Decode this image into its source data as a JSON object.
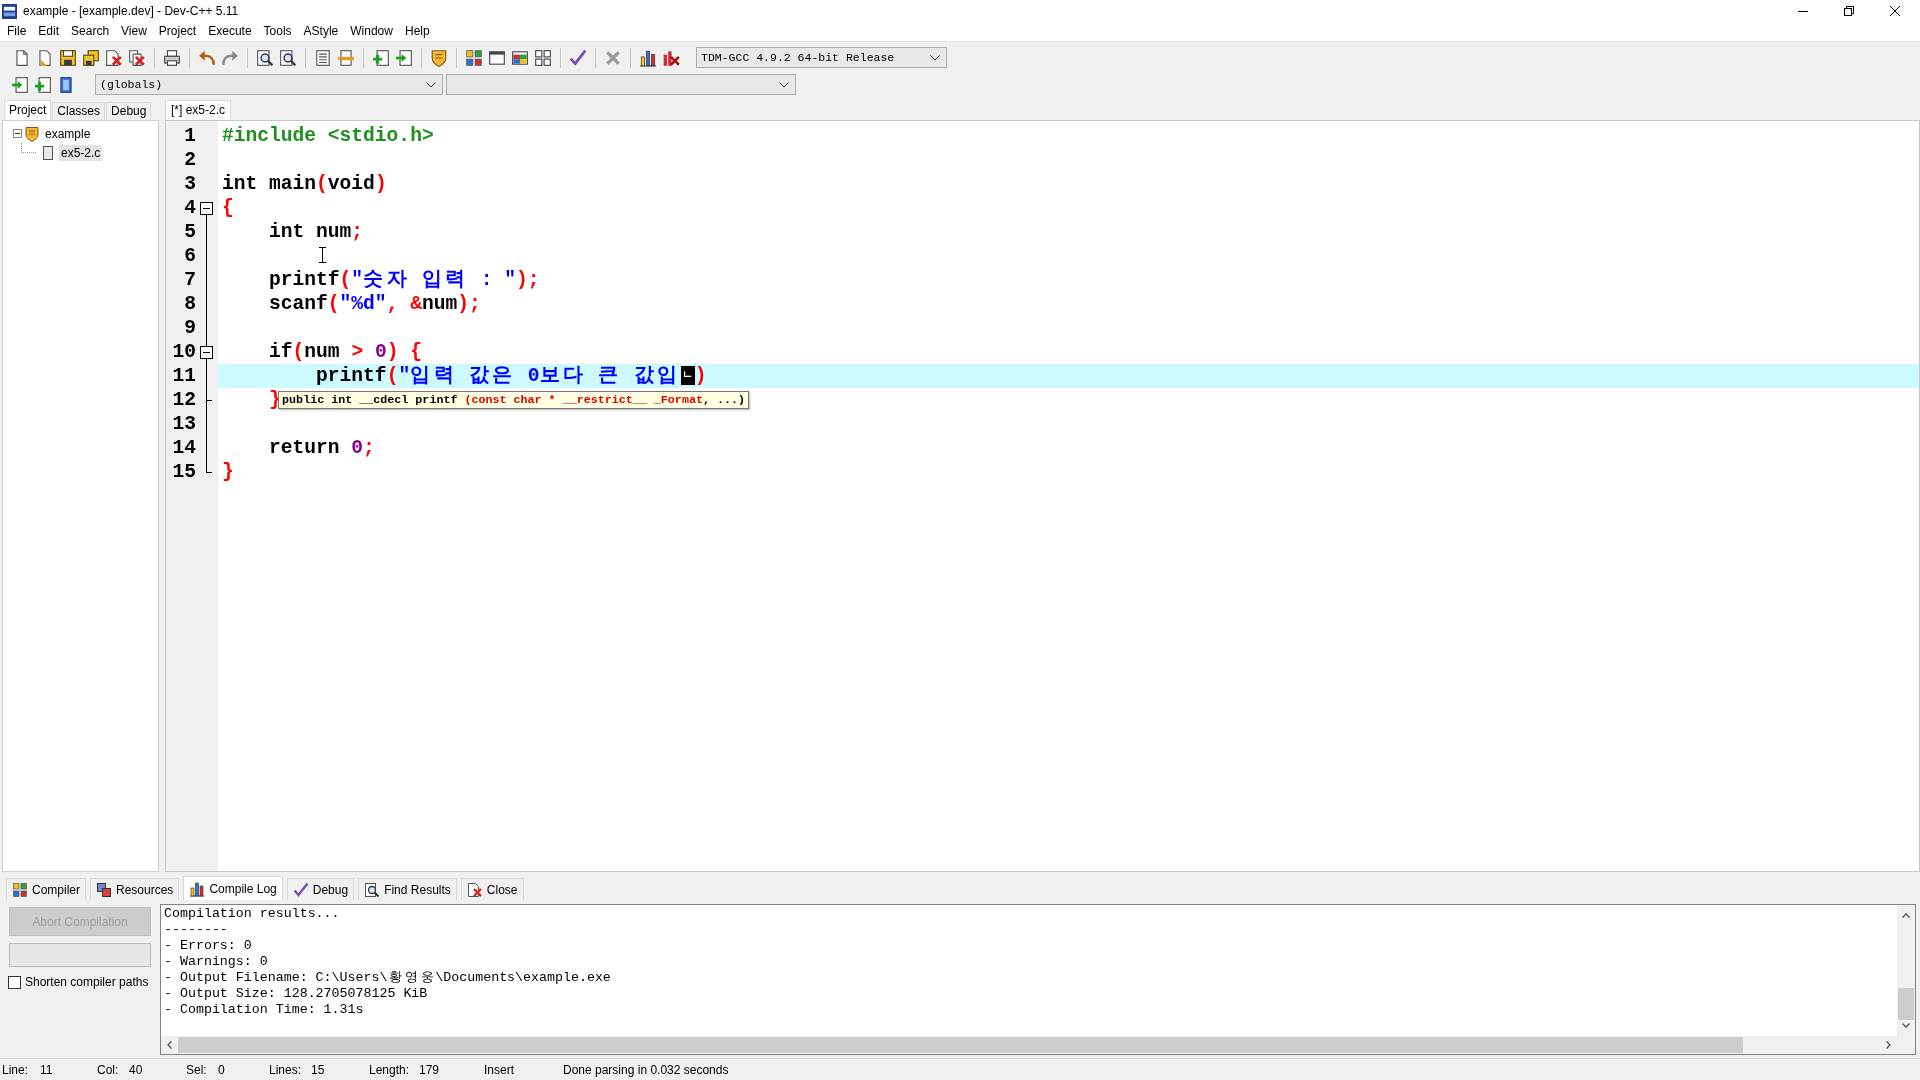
{
  "window": {
    "title": "example - [example.dev] - Dev-C++ 5.11"
  },
  "menu": [
    "File",
    "Edit",
    "Search",
    "View",
    "Project",
    "Execute",
    "Tools",
    "AStyle",
    "Window",
    "Help"
  ],
  "toolbar": {
    "compiler": "TDM-GCC 4.9.2 64-bit Release",
    "scope": "(globals)"
  },
  "side_panel": {
    "tabs": [
      {
        "label": "Project",
        "selected": true
      },
      {
        "label": "Classes",
        "selected": false
      },
      {
        "label": "Debug",
        "selected": false
      }
    ],
    "tree": [
      {
        "label": "example",
        "expanded": true,
        "selected": false,
        "children": [
          {
            "label": "ex5-2.c",
            "selected": true
          }
        ]
      }
    ]
  },
  "editor": {
    "tabs": [
      {
        "label": "[*] ex5-2.c",
        "selected": true
      }
    ],
    "lines": [
      {
        "number": "1",
        "kind": "line",
        "selected": false,
        "tokens": [
          {
            "kind": "preprocessor",
            "text": "#include <stdio.h>"
          }
        ]
      },
      {
        "number": "2",
        "kind": "line",
        "selected": false
      },
      {
        "number": "3",
        "kind": "line",
        "selected": false,
        "tokens": [
          {
            "kind": "plain",
            "text": "int main"
          },
          {
            "kind": "symbol",
            "text": "("
          },
          {
            "kind": "plain",
            "text": "void"
          },
          {
            "kind": "symbol",
            "text": ")"
          }
        ]
      },
      {
        "number": "4",
        "kind": "foldstart",
        "selected": false,
        "tokens": [
          {
            "kind": "symbol",
            "text": "{"
          }
        ]
      },
      {
        "number": "5",
        "kind": "line",
        "selected": false,
        "tokens": [
          {
            "kind": "plain",
            "text": "    int num"
          },
          {
            "kind": "symbol",
            "text": ";"
          }
        ]
      },
      {
        "number": "6",
        "kind": "line",
        "selected": false
      },
      {
        "number": "7",
        "kind": "line",
        "selected": false,
        "tokens": [
          {
            "kind": "plain",
            "text": "    printf"
          },
          {
            "kind": "symbol",
            "text": "("
          },
          {
            "kind": "string",
            "text": "\"숫자 입력 : \""
          },
          {
            "kind": "symbol",
            "text": ");"
          }
        ]
      },
      {
        "number": "8",
        "kind": "line",
        "selected": false,
        "tokens": [
          {
            "kind": "plain",
            "text": "    scanf"
          },
          {
            "kind": "symbol",
            "text": "("
          },
          {
            "kind": "string",
            "text": "\"%d\""
          },
          {
            "kind": "symbol",
            "text": ", &"
          },
          {
            "kind": "plain",
            "text": "num"
          },
          {
            "kind": "symbol",
            "text": ");"
          }
        ]
      },
      {
        "number": "9",
        "kind": "line",
        "selected": false
      },
      {
        "number": "10",
        "kind": "foldstart",
        "selected": false,
        "tokens": [
          {
            "kind": "plain",
            "text": "    if"
          },
          {
            "kind": "symbol",
            "text": "("
          },
          {
            "kind": "plain",
            "text": "num "
          },
          {
            "kind": "symbol",
            "text": "> "
          },
          {
            "kind": "number",
            "text": "0"
          },
          {
            "kind": "symbol",
            "text": ") {"
          }
        ]
      },
      {
        "number": "11",
        "kind": "line",
        "selected": true,
        "tokens": [
          {
            "kind": "plain",
            "text": "        printf"
          },
          {
            "kind": "symbol",
            "text": "("
          },
          {
            "kind": "string",
            "text": "\"입력 값은 0보다 큰 값입"
          },
          {
            "kind": "composing",
            "text": "ㄴ"
          },
          {
            "kind": "symbol",
            "text": ")"
          }
        ]
      },
      {
        "number": "12",
        "kind": "foldend",
        "selected": false,
        "tokens": [
          {
            "kind": "symbol",
            "text": "    }"
          }
        ]
      },
      {
        "number": "13",
        "kind": "line",
        "selected": false
      },
      {
        "number": "14",
        "kind": "line",
        "selected": false,
        "tokens": [
          {
            "kind": "plain",
            "text": "    return "
          },
          {
            "kind": "number",
            "text": "0"
          },
          {
            "kind": "symbol",
            "text": ";"
          }
        ]
      },
      {
        "number": "15",
        "kind": "foldend",
        "selected": false,
        "tokens": [
          {
            "kind": "symbol",
            "text": "}"
          }
        ]
      }
    ],
    "calltip": [
      {
        "text": "public int __cdecl printf ",
        "highlighted": false
      },
      {
        "text": "(const char * __restrict__ _Format",
        "highlighted": true
      },
      {
        "text": ", ...)",
        "highlighted": false
      }
    ]
  },
  "bottom_panel": {
    "tabs": [
      {
        "label": "Compiler",
        "selected": false
      },
      {
        "label": "Resources",
        "selected": false
      },
      {
        "label": "Compile Log",
        "selected": true
      },
      {
        "label": "Debug",
        "selected": false
      },
      {
        "label": "Find Results",
        "selected": false
      },
      {
        "label": "Close",
        "selected": false
      }
    ],
    "abort_button": {
      "label": "Abort Compilation",
      "disabled": true
    },
    "shorten_paths": {
      "label": "Shorten compiler paths",
      "checked": false
    },
    "log": [
      "Compilation results...",
      "--------",
      "- Errors: 0",
      "- Warnings: 0",
      "- Output Filename: C:\\Users\\황영웅\\Documents\\example.exe",
      "- Output Size: 128.2705078125 KiB",
      "- Compilation Time: 1.31s"
    ]
  },
  "status_bar": [
    {
      "label": "Line:",
      "value": "11"
    },
    {
      "label": "Col:",
      "value": "40"
    },
    {
      "label": "Sel:",
      "value": "0"
    },
    {
      "label": "Lines:",
      "value": "15"
    },
    {
      "label": "Length:",
      "value": "179"
    },
    {
      "text": "Insert"
    },
    {
      "text": "Done parsing in 0.032 seconds"
    }
  ]
}
